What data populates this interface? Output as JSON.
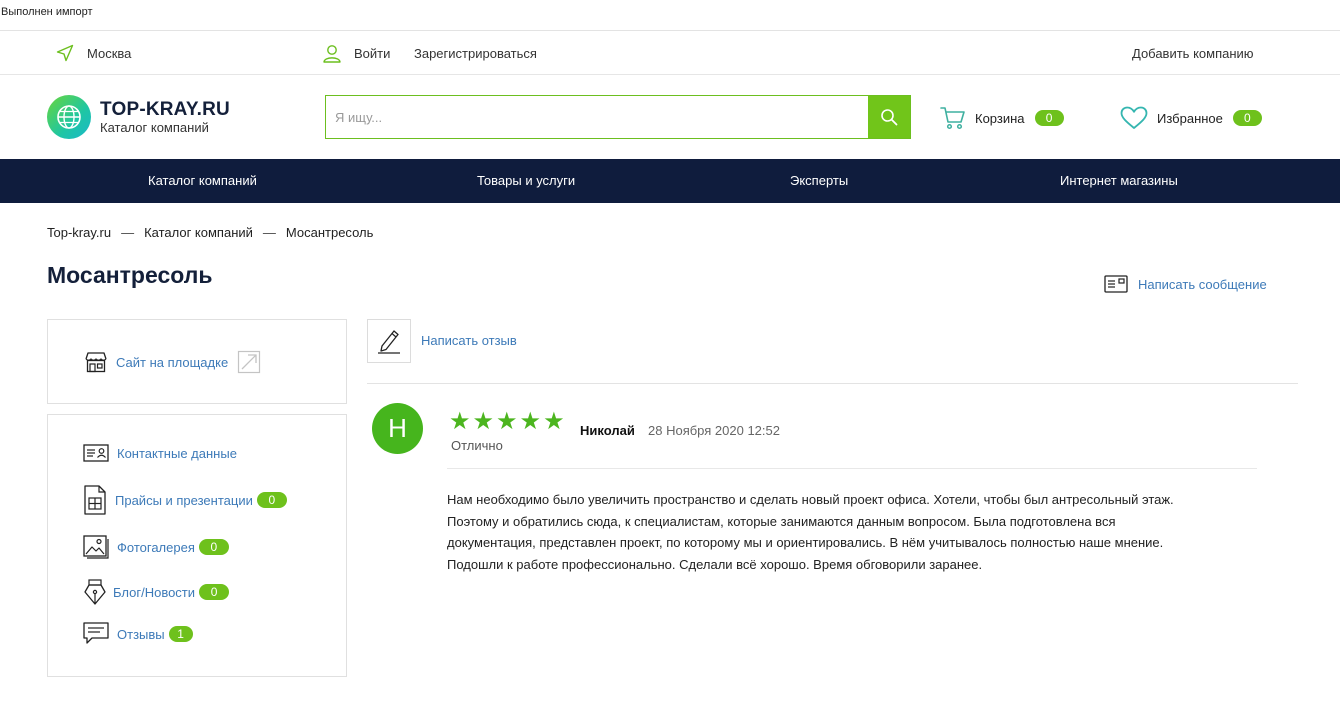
{
  "status": {
    "text": "Выполнен импорт"
  },
  "topbar": {
    "city": "Москва",
    "login": "Войти",
    "register": "Зарегистрироваться",
    "add_company": "Добавить компанию"
  },
  "header": {
    "logo_title": "TOP-KRAY.RU",
    "logo_subtitle": "Каталог компаний",
    "search_placeholder": "Я ищу...",
    "cart_label": "Корзина",
    "cart_count": "0",
    "favorites_label": "Избранное",
    "favorites_count": "0"
  },
  "nav": {
    "items": [
      "Каталог компаний",
      "Товары и услуги",
      "Эксперты",
      "Интернет магазины"
    ]
  },
  "breadcrumb": {
    "items": [
      "Top-kray.ru",
      "Каталог компаний",
      "Мосантресоль"
    ],
    "separator": "—"
  },
  "page": {
    "title": "Мосантресоль",
    "write_message": "Написать сообщение"
  },
  "sidebar": {
    "site_link": "Сайт на площадке",
    "menu": [
      {
        "label": "Контактные данные",
        "icon": "contact-card-icon"
      },
      {
        "label": "Прайсы и презентации",
        "count": "0",
        "icon": "document-icon"
      },
      {
        "label": "Фотогалерея",
        "count": "0",
        "icon": "photo-icon"
      },
      {
        "label": "Блог/Новости",
        "count": "0",
        "icon": "pen-nib-icon"
      },
      {
        "label": "Отзывы",
        "count": "1",
        "icon": "chat-icon"
      }
    ]
  },
  "reviews": {
    "write_review": "Написать отзыв",
    "items": [
      {
        "avatar_letter": "Н",
        "stars": 5,
        "rating_label": "Отлично",
        "author": "Николай",
        "date": "28 Ноября 2020 12:52",
        "lines": [
          "Нам необходимо было увеличить пространство и сделать новый проект офиса. Хотели, чтобы был антресольный этаж.",
          "Поэтому и обратились сюда, к специалистам, которые занимаются данным вопросом. Была подготовлена вся",
          "документация, представлен проект, по которому мы и ориентировались. В нём учитывалось полностью наше мнение.",
          "Подошли к работе профессионально. Сделали всё хорошо. Время обговорили заранее."
        ]
      }
    ]
  },
  "colors": {
    "accent_green": "#71c51a",
    "nav_dark": "#0f1c3d",
    "link_blue": "#3d7ab8"
  }
}
